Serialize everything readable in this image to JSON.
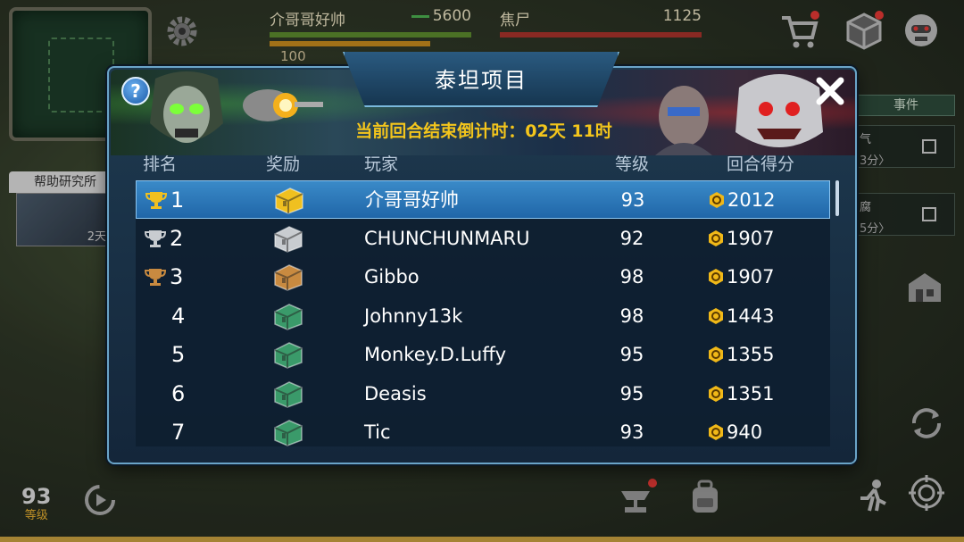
{
  "hud": {
    "player_name": "介哥哥好帅",
    "player_power": "5600",
    "resource": "100",
    "enemy_name": "焦尸",
    "enemy_value": "1125",
    "level": "93",
    "level_label": "等级",
    "side_tab": "事件",
    "side_line1_suffix": "气",
    "side_line1_sub": "3分〉",
    "side_line2_suffix": "腐",
    "side_line2_sub": "5分〉",
    "help_research": "帮助研究所",
    "help_timer": "2天"
  },
  "modal": {
    "title": "泰坦项目",
    "countdown": "当前回合结束倒计时：02天 11时",
    "help_label": "?",
    "columns": {
      "rank": "排名",
      "reward": "奖励",
      "player": "玩家",
      "level": "等级",
      "score": "回合得分"
    }
  },
  "rows": [
    {
      "rank": "1",
      "trophy": "gold",
      "chest": "gold",
      "player": "介哥哥好帅",
      "level": "93",
      "score": "2012",
      "selected": true
    },
    {
      "rank": "2",
      "trophy": "silver",
      "chest": "silver",
      "player": "CHUNCHUNMARU",
      "level": "92",
      "score": "1907"
    },
    {
      "rank": "3",
      "trophy": "bronze",
      "chest": "bronze",
      "player": "Gibbo",
      "level": "98",
      "score": "1907"
    },
    {
      "rank": "4",
      "trophy": "",
      "chest": "green",
      "player": "Johnny13k",
      "level": "98",
      "score": "1443"
    },
    {
      "rank": "5",
      "trophy": "",
      "chest": "green",
      "player": "Monkey.D.Luffy",
      "level": "95",
      "score": "1355"
    },
    {
      "rank": "6",
      "trophy": "",
      "chest": "green",
      "player": "Deasis",
      "level": "95",
      "score": "1351"
    },
    {
      "rank": "7",
      "trophy": "",
      "chest": "green",
      "player": "Tic",
      "level": "93",
      "score": "940"
    }
  ],
  "colors": {
    "gold": "#f0c020",
    "silver": "#c8ccd0",
    "bronze": "#c88a40",
    "green": "#3a9a6a",
    "countdown": "#f3c51c",
    "selected_row": "#2e7ab8",
    "coin": "#f0b818"
  }
}
